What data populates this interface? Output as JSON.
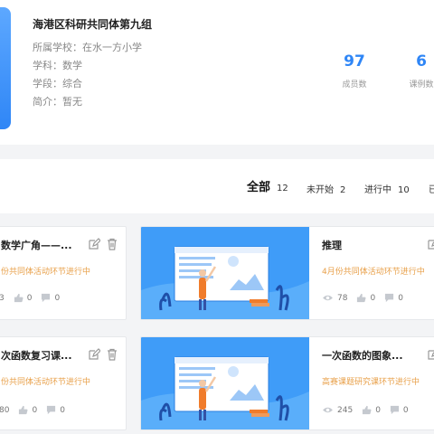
{
  "group": {
    "title": "海港区科研共同体第九组",
    "school_label": "所属学校：",
    "school": "在水一方小学",
    "subject_label": "学科：",
    "subject": "数学",
    "stage_label": "学段：",
    "stage": "综合",
    "intro_label": "简介：",
    "intro": "暂无"
  },
  "stats": [
    {
      "value": "97",
      "label": "成员数"
    },
    {
      "value": "6",
      "label": "课例数"
    }
  ],
  "tabs": [
    {
      "label": "全部",
      "count": "12"
    },
    {
      "label": "未开始",
      "count": "2"
    },
    {
      "label": "进行中",
      "count": "10"
    },
    {
      "label": "已"
    }
  ],
  "cards": [
    {
      "title": "数学广角——...",
      "subtitle": "份共同体活动环节进行中",
      "views": "3",
      "likes": "0",
      "comments": "0"
    },
    {
      "title": "推理",
      "subtitle": "4月份共同体活动环节进行中",
      "views": "78",
      "likes": "0",
      "comments": "0"
    },
    {
      "title": "次函数复习课...",
      "subtitle": "份共同体活动环节进行中",
      "views": "80",
      "likes": "0",
      "comments": "0"
    },
    {
      "title": "一次函数的图象...",
      "subtitle": "高赛课题研究课环节进行中",
      "views": "245",
      "likes": "0",
      "comments": "0"
    }
  ],
  "colors": {
    "accent": "#2f86f6",
    "status": "#e8a04a"
  }
}
